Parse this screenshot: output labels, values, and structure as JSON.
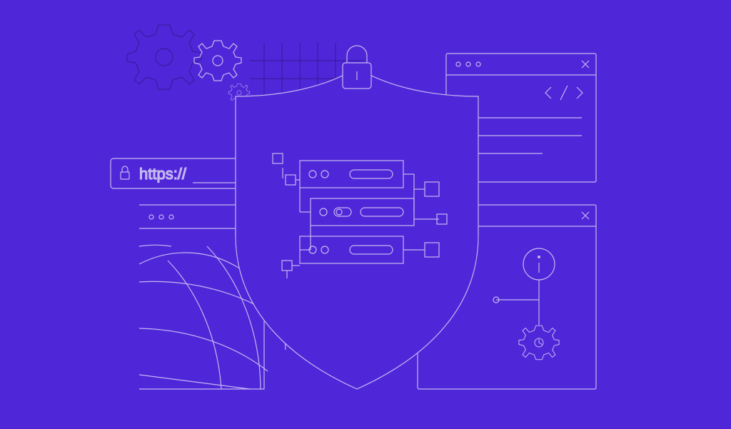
{
  "illustration": {
    "theme": "web-security-infrastructure",
    "background_color": "#5026d9",
    "stroke_color": "#c4b8f0",
    "stroke_color_dark": "#3a1c9e",
    "address_bar": {
      "protocol_text": "https://",
      "icon": "lock-icon"
    },
    "elements": [
      "gear-icons",
      "grid-pattern",
      "address-bar",
      "browser-window-globe",
      "shield-padlock",
      "server-racks",
      "code-window",
      "info-window",
      "connection-nodes"
    ]
  }
}
